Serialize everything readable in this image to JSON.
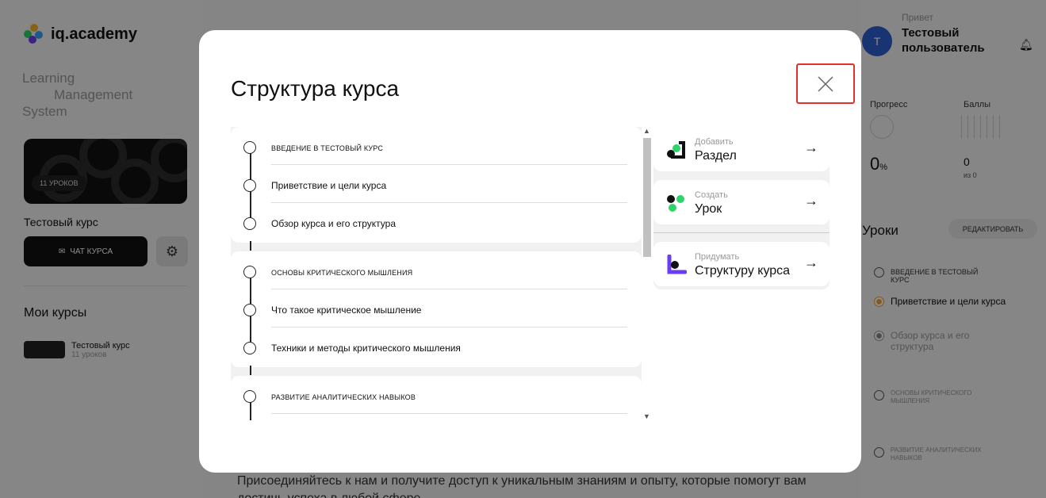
{
  "brand": {
    "name": "iq.academy",
    "subtitle_line1": "Learning",
    "subtitle_line2": "Management",
    "subtitle_line3": "System"
  },
  "sidebar": {
    "lessons_pill": "11 УРОКОВ",
    "course_title": "Тестовый курс",
    "chat_button": "ЧАТ КУРСА",
    "my_courses_heading": "Мои курсы",
    "mini_course_title": "Тестовый курс",
    "mini_course_sub": "11 уроков"
  },
  "background_text": "Присоединяйтесь к нам и получите доступ к уникальным знаниям и опыту, которые помогут вам достичь успеха в любой сфере.",
  "user": {
    "avatar_letter": "Т",
    "greeting": "Привет",
    "name": "Тестовый пользователь"
  },
  "stats": {
    "progress_label": "Прогресс",
    "progress_value": "0",
    "progress_unit": "%",
    "score_label": "Баллы",
    "score_value": "0",
    "score_sub": "из 0"
  },
  "lessons_panel": {
    "heading": "Уроки",
    "edit_button": "РЕДАКТИРОВАТЬ",
    "items": [
      {
        "label": "ВВЕДЕНИЕ В ТЕСТОВЫЙ КУРС"
      },
      {
        "label": "Приветствие и цели курса"
      },
      {
        "label": "Обзор курса и его структура"
      },
      {
        "label": "ОСНОВЫ КРИТИЧЕСКОГО МЫШЛЕНИЯ"
      },
      {
        "label": "РАЗВИТИЕ АНАЛИТИЧЕСКИХ НАВЫКОВ"
      }
    ]
  },
  "modal": {
    "title": "Структура курса",
    "structure": [
      {
        "label": "ВВЕДЕНИЕ В ТЕСТОВЫЙ КУРС"
      },
      {
        "label": "Приветствие и цели курса"
      },
      {
        "label": "Обзор курса и его структура"
      },
      {
        "label": "ОСНОВЫ КРИТИЧЕСКОГО МЫШЛЕНИЯ"
      },
      {
        "label": "Что такое критическое мышление"
      },
      {
        "label": "Техники и методы критического мышления"
      },
      {
        "label": "РАЗВИТИЕ АНАЛИТИЧЕСКИХ НАВЫКОВ"
      }
    ],
    "actions": [
      {
        "small": "Добавить",
        "big": "Раздел",
        "icon": "section-icon"
      },
      {
        "small": "Создать",
        "big": "Урок",
        "icon": "lesson-icon"
      },
      {
        "small": "Придумать",
        "big": "Структуру курса",
        "icon": "ai-structure-icon"
      }
    ]
  },
  "colors": {
    "accent_green": "#2fd36a",
    "accent_purple": "#6a3df0",
    "highlight_red": "#e0322a",
    "avatar_blue": "#2f5fd0"
  }
}
